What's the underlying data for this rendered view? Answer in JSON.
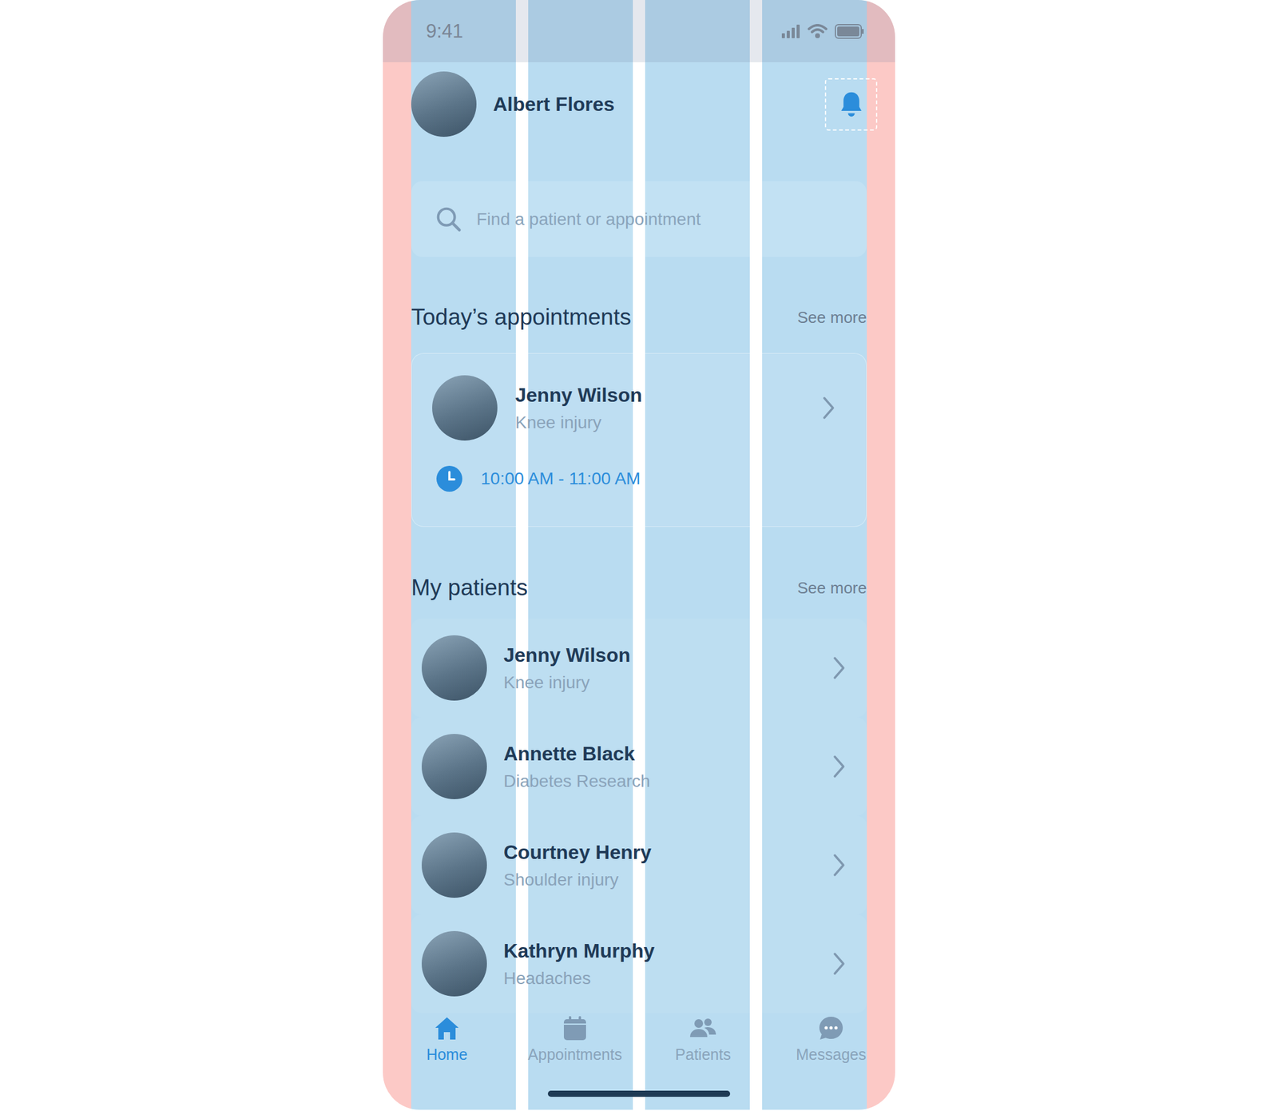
{
  "status_bar": {
    "time": "9:41"
  },
  "user": {
    "name": "Albert Flores"
  },
  "search": {
    "placeholder": "Find a patient or appointment"
  },
  "appointments": {
    "title": "Today’s appointments",
    "see_more": "See more",
    "items": [
      {
        "name": "Jenny Wilson",
        "condition": "Knee injury",
        "time": "10:00 AM - 11:00 AM"
      }
    ]
  },
  "patients": {
    "title": "My patients",
    "see_more": "See more",
    "items": [
      {
        "name": "Jenny Wilson",
        "condition": "Knee injury"
      },
      {
        "name": "Annette Black",
        "condition": "Diabetes Research"
      },
      {
        "name": "Courtney Henry",
        "condition": "Shoulder injury"
      },
      {
        "name": "Kathryn Murphy",
        "condition": "Headaches"
      }
    ]
  },
  "nav": [
    {
      "label": "Home",
      "selected": true
    },
    {
      "label": "Appointments",
      "selected": false
    },
    {
      "label": "Patients",
      "selected": false
    },
    {
      "label": "Messages",
      "selected": false
    }
  ]
}
